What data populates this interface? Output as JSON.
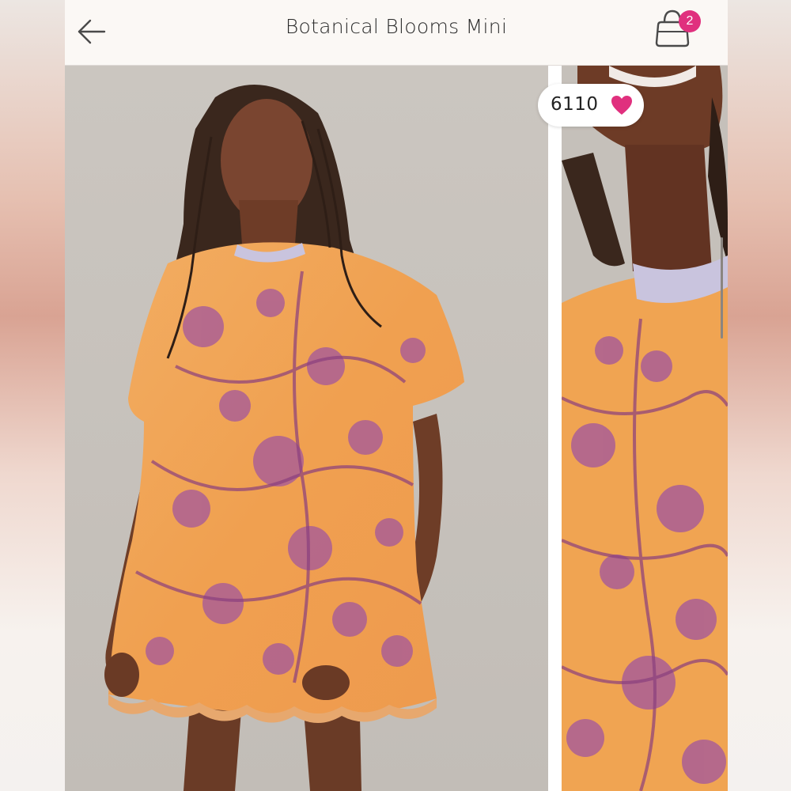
{
  "header": {
    "title": "Botanical Blooms Mini",
    "back_icon": "arrow-left-icon",
    "cart_icon": "shopping-bag-icon",
    "cart_count": "2",
    "badge_color": "#e0307e"
  },
  "gallery": {
    "main_image": "model-wearing-floral-velvet-mini-dress",
    "detail_image": "closeup-neckline-floral-print",
    "likes_count": "6110",
    "like_icon": "heart-icon",
    "heart_color": "#e0307e"
  },
  "colors": {
    "dress_orange": "#f1a458",
    "floral_purple": "#a65a9a",
    "collar_lavender": "#c9c4de"
  }
}
